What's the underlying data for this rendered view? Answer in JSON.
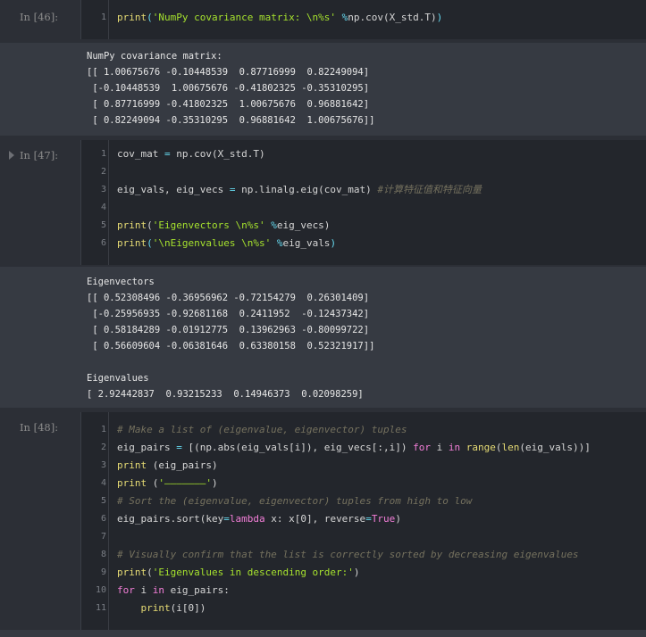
{
  "cells": [
    {
      "prompt": "In  [46]:",
      "lines": [
        {
          "n": "1",
          "parts": [
            [
              "fn",
              "print"
            ],
            [
              "op",
              "("
            ],
            [
              "str",
              "'NumPy covariance matrix: \\n%s' "
            ],
            [
              "op",
              "%"
            ],
            [
              "plain",
              "np.cov(X_std.T)"
            ],
            [
              "op",
              ")"
            ]
          ]
        }
      ],
      "output": "NumPy covariance matrix:\n[[ 1.00675676 -0.10448539  0.87716999  0.82249094]\n [-0.10448539  1.00675676 -0.41802325 -0.35310295]\n [ 0.87716999 -0.41802325  1.00675676  0.96881642]\n [ 0.82249094 -0.35310295  0.96881642  1.00675676]]"
    },
    {
      "prompt": "In  [47]:",
      "lines": [
        {
          "n": "1",
          "parts": [
            [
              "plain",
              "cov_mat "
            ],
            [
              "op",
              "="
            ],
            [
              "plain",
              " np.cov(X_std.T)"
            ]
          ]
        },
        {
          "n": "2",
          "parts": []
        },
        {
          "n": "3",
          "parts": [
            [
              "plain",
              "eig_vals, eig_vecs "
            ],
            [
              "op",
              "="
            ],
            [
              "plain",
              " np.linalg.eig(cov_mat) "
            ],
            [
              "cm",
              "#计算特征值和特征向量"
            ]
          ]
        },
        {
          "n": "4",
          "parts": []
        },
        {
          "n": "5",
          "parts": [
            [
              "fn",
              "print"
            ],
            [
              "plain",
              "("
            ],
            [
              "str",
              "'Eigenvectors \\n%s' "
            ],
            [
              "op",
              "%"
            ],
            [
              "plain",
              "eig_vecs)"
            ]
          ]
        },
        {
          "n": "6",
          "parts": [
            [
              "fn",
              "print"
            ],
            [
              "op",
              "("
            ],
            [
              "str",
              "'\\nEigenvalues \\n%s' "
            ],
            [
              "op",
              "%"
            ],
            [
              "plain",
              "eig_vals"
            ],
            [
              "op",
              ")"
            ]
          ]
        }
      ],
      "output": "Eigenvectors\n[[ 0.52308496 -0.36956962 -0.72154279  0.26301409]\n [-0.25956935 -0.92681168  0.2411952  -0.12437342]\n [ 0.58184289 -0.01912775  0.13962963 -0.80099722]\n [ 0.56609604 -0.06381646  0.63380158  0.52321917]]\n\nEigenvalues\n[ 2.92442837  0.93215233  0.14946373  0.02098259]"
    },
    {
      "prompt": "In  [48]:",
      "lines": [
        {
          "n": "1",
          "parts": [
            [
              "cm",
              "# Make a list of (eigenvalue, eigenvector) tuples"
            ]
          ]
        },
        {
          "n": "2",
          "parts": [
            [
              "plain",
              "eig_pairs "
            ],
            [
              "op",
              "="
            ],
            [
              "plain",
              " [(np.abs(eig_vals[i]), eig_vecs[:,i]) "
            ],
            [
              "kw",
              "for"
            ],
            [
              "plain",
              " i "
            ],
            [
              "kw",
              "in"
            ],
            [
              "plain",
              " "
            ],
            [
              "fn",
              "range"
            ],
            [
              "plain",
              "("
            ],
            [
              "fn",
              "len"
            ],
            [
              "plain",
              "(eig_vals))]"
            ]
          ]
        },
        {
          "n": "3",
          "parts": [
            [
              "fn",
              "print"
            ],
            [
              "plain",
              " (eig_pairs)"
            ]
          ]
        },
        {
          "n": "4",
          "parts": [
            [
              "fn",
              "print"
            ],
            [
              "plain",
              " ("
            ],
            [
              "str",
              "'———————'"
            ],
            [
              "plain",
              ")"
            ]
          ]
        },
        {
          "n": "5",
          "parts": [
            [
              "cm",
              "# Sort the (eigenvalue, eigenvector) tuples from high to low"
            ]
          ]
        },
        {
          "n": "6",
          "parts": [
            [
              "plain",
              "eig_pairs.sort(key"
            ],
            [
              "op",
              "="
            ],
            [
              "kw",
              "lambda"
            ],
            [
              "plain",
              " x: x[0], reverse"
            ],
            [
              "op",
              "="
            ],
            [
              "kw",
              "True"
            ],
            [
              "plain",
              ")"
            ]
          ]
        },
        {
          "n": "7",
          "parts": []
        },
        {
          "n": "8",
          "parts": [
            [
              "cm",
              "# Visually confirm that the list is correctly sorted by decreasing eigenvalues"
            ]
          ]
        },
        {
          "n": "9",
          "parts": [
            [
              "fn",
              "print"
            ],
            [
              "plain",
              "("
            ],
            [
              "str",
              "'Eigenvalues in descending order:'"
            ],
            [
              "plain",
              ")"
            ]
          ]
        },
        {
          "n": "10",
          "parts": [
            [
              "kw",
              "for"
            ],
            [
              "plain",
              " i "
            ],
            [
              "kw",
              "in"
            ],
            [
              "plain",
              " eig_pairs:"
            ]
          ]
        },
        {
          "n": "11",
          "parts": [
            [
              "plain",
              "    "
            ],
            [
              "fn",
              "print"
            ],
            [
              "plain",
              "(i[0])"
            ]
          ]
        }
      ],
      "output": ""
    }
  ]
}
